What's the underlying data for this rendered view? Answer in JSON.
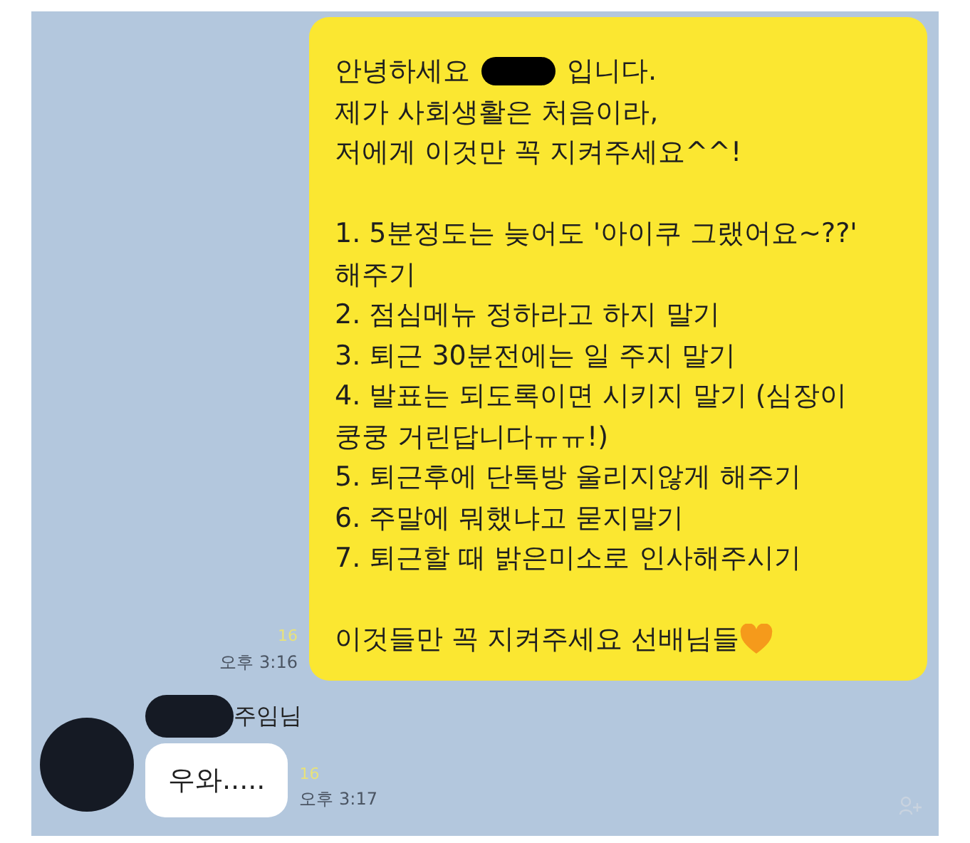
{
  "messages": [
    {
      "kind": "sent",
      "greeting": {
        "before": "안녕하세요",
        "after": "입니다."
      },
      "intro_lines": [
        "제가 사회생활은 처음이라,",
        "저에게 이것만 꼭 지켜주세요^^!"
      ],
      "rules": [
        {
          "lines": [
            "1. 5분정도는 늦어도 '아이쿠 그랬어요~??'",
            "해주기"
          ]
        },
        {
          "lines": [
            "2. 점심메뉴 정하라고 하지 말기"
          ]
        },
        {
          "lines": [
            "3. 퇴근 30분전에는 일 주지 말기"
          ]
        },
        {
          "lines": [
            "4. 발표는 되도록이면 시키지 말기 (심장이",
            "쿵쿵 거린답니다ㅠㅠ!)"
          ]
        },
        {
          "lines": [
            "5. 퇴근후에 단톡방 울리지않게 해주기"
          ]
        },
        {
          "lines": [
            "6. 주말에 뭐했냐고 묻지말기"
          ]
        },
        {
          "lines": [
            "7. 퇴근할 때 밝은미소로 인사해주시기"
          ]
        }
      ],
      "closing": "이것들만 꼭 지켜주세요 선배님들",
      "read_count": "16",
      "time": "오후 3:16"
    },
    {
      "kind": "received",
      "sender": "주임님",
      "text": "우와.....",
      "read_count": "16",
      "time": "오후 3:17"
    }
  ]
}
